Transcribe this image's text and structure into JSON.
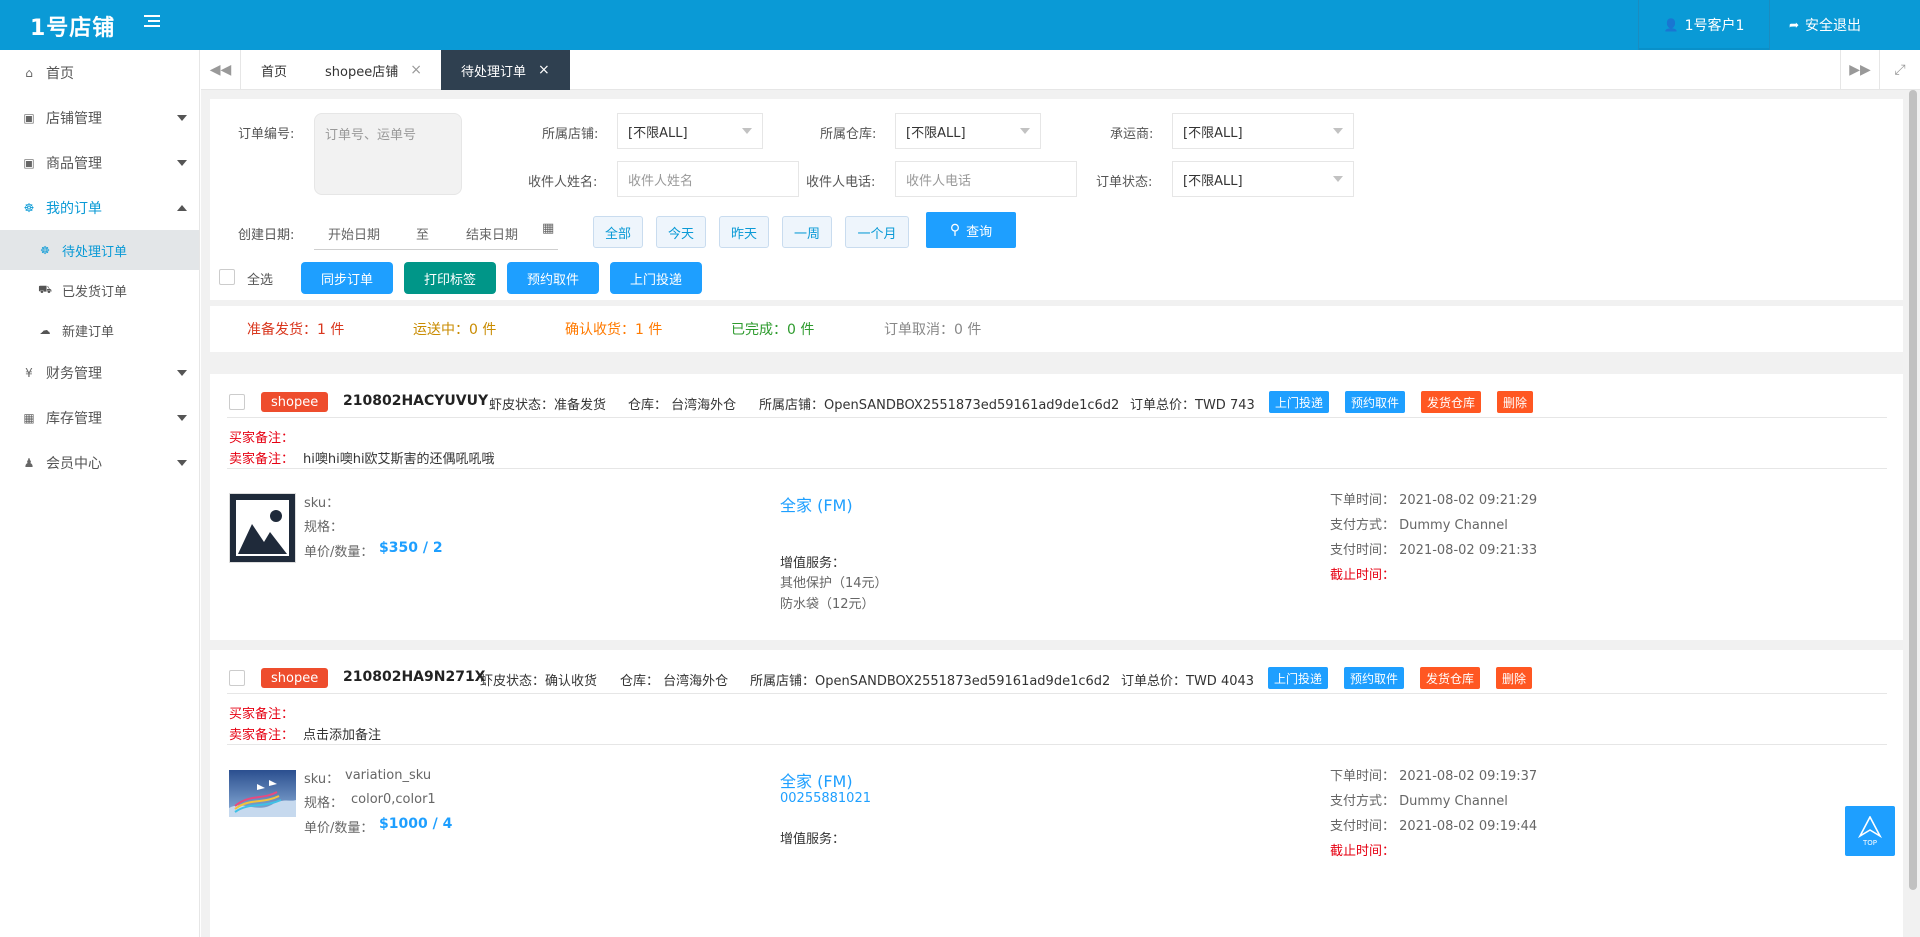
{
  "header": {
    "logo": "1号店铺",
    "user": "1号客户1",
    "logout": "安全退出"
  },
  "sidebar": {
    "items": [
      {
        "label": "首页",
        "icon": "home-icon"
      },
      {
        "label": "店铺管理",
        "icon": "bag-icon"
      },
      {
        "label": "商品管理",
        "icon": "bag-icon"
      },
      {
        "label": "我的订单",
        "icon": "cart-icon"
      },
      {
        "label": "财务管理",
        "icon": "yen-icon"
      },
      {
        "label": "库存管理",
        "icon": "table-icon"
      },
      {
        "label": "会员中心",
        "icon": "person-icon"
      }
    ],
    "sub_items": [
      {
        "label": "待处理订单",
        "icon": "cart-icon"
      },
      {
        "label": "已发货订单",
        "icon": "truck-icon"
      },
      {
        "label": "新建订单",
        "icon": "cloud-upload-icon"
      }
    ]
  },
  "tabs": [
    {
      "label": "首页"
    },
    {
      "label": "shopee店铺"
    },
    {
      "label": "待处理订单"
    }
  ],
  "filters": {
    "order_no_label": "订单编号:",
    "order_no_placeholder": "订单号、运单号",
    "shop_label": "所属店铺:",
    "shop_value": "[不限ALL]",
    "warehouse_label": "所属仓库:",
    "warehouse_value": "[不限ALL]",
    "carrier_label": "承运商:",
    "carrier_value": "[不限ALL]",
    "receiver_name_label": "收件人姓名:",
    "receiver_name_placeholder": "收件人姓名",
    "receiver_phone_label": "收件人电话:",
    "receiver_phone_placeholder": "收件人电话",
    "status_label": "订单状态:",
    "status_value": "[不限ALL]",
    "date_label": "创建日期:",
    "start_date": "开始日期",
    "to": "至",
    "end_date": "结束日期",
    "quick": [
      "全部",
      "今天",
      "昨天",
      "一周",
      "一个月"
    ],
    "search": "查询"
  },
  "actions": {
    "select_all": "全选",
    "sync": "同步订单",
    "print": "打印标签",
    "pickup": "预约取件",
    "door": "上门投递"
  },
  "stats": [
    {
      "label": "准备发货：1 件",
      "color": "#d9371e"
    },
    {
      "label": "运送中：0 件",
      "color": "#c98b00"
    },
    {
      "label": "确认收货：1 件",
      "color": "#ff7a00"
    },
    {
      "label": "已完成：0 件",
      "color": "#2e9b2e"
    },
    {
      "label": "订单取消：0 件",
      "color": "#888888"
    }
  ],
  "orders": [
    {
      "platform": "shopee",
      "order_no": "210802HACYUVUY",
      "shopee_status": "虾皮状态：准备发货",
      "warehouse": "仓库：  台湾海外仓",
      "shop": "所属店铺：OpenSANDBOX2551873ed59161ad9de1c6d2",
      "total": "订单总价：TWD 743",
      "btns": [
        "上门投递",
        "预约取件",
        "发货仓库",
        "删除"
      ],
      "buyer_note_label": "买家备注：",
      "seller_note_label": "卖家备注：",
      "seller_note": "hi噢hi噢hi欧艾斯害的还偶吼吼哦",
      "sku_label": "sku：",
      "sku": "",
      "spec_label": "规格：",
      "spec": "",
      "price_label": "单价/数量：",
      "price": "$350 / 2",
      "carrier": "全家 (FM)",
      "tracking": "",
      "vas_label": "增值服务：",
      "vas": [
        "其他保护（14元）",
        "防水袋（12元）"
      ],
      "order_time": "下单时间：  2021-08-02 09:21:29",
      "pay_method": "支付方式：  Dummy Channel",
      "pay_time": "支付时间：  2021-08-02 09:21:33",
      "deadline": "截止时间："
    },
    {
      "platform": "shopee",
      "order_no": "210802HA9N271X",
      "shopee_status": "虾皮状态：确认收货",
      "warehouse": "仓库：  台湾海外仓",
      "shop": "所属店铺：OpenSANDBOX2551873ed59161ad9de1c6d2",
      "total": "订单总价：TWD 4043",
      "btns": [
        "上门投递",
        "预约取件",
        "发货仓库",
        "删除"
      ],
      "buyer_note_label": "买家备注：",
      "seller_note_label": "卖家备注：",
      "seller_note": "点击添加备注",
      "sku_label": "sku：",
      "sku": "variation_sku",
      "spec_label": "规格：",
      "spec": "color0,color1",
      "price_label": "单价/数量：",
      "price": "$1000 / 4",
      "carrier": "全家 (FM)",
      "tracking": "00255881021",
      "vas_label": "增值服务：",
      "order_time": "下单时间：  2021-08-02 09:19:37",
      "pay_method": "支付方式：  Dummy Channel",
      "pay_time": "支付时间：  2021-08-02 09:19:44",
      "deadline": "截止时间："
    }
  ],
  "top_button": "TOP"
}
